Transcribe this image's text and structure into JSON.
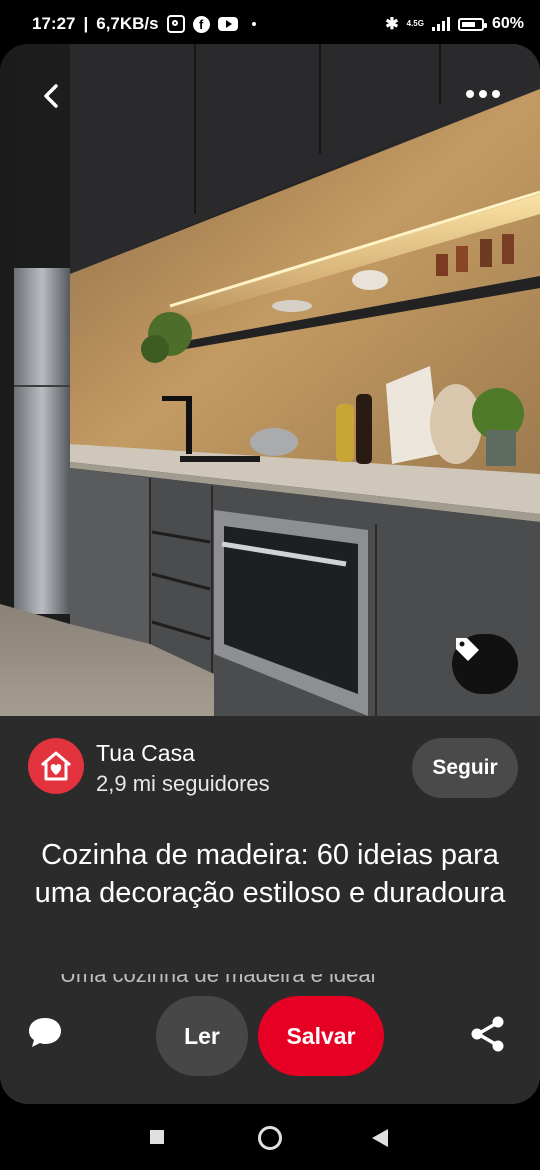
{
  "status_bar": {
    "time": "17:27",
    "speed": "6,7KB/s",
    "network": "4.5G",
    "battery": "60%"
  },
  "icons": {
    "back": "chevron-left-icon",
    "more": "more-horizontal-icon",
    "tag": "tag-icon",
    "comment": "speech-bubble-icon",
    "share": "share-icon"
  },
  "creator": {
    "name": "Tua Casa",
    "followers": "2,9 mi seguidores",
    "follow_label": "Seguir"
  },
  "pin": {
    "title": "Cozinha de madeira: 60 ideias para uma decoração estiloso e duradoura",
    "description_peek": "Uma cozinha de madeira é ideal"
  },
  "actions": {
    "read_label": "Ler",
    "save_label": "Salvar"
  },
  "colors": {
    "save": "#e60023",
    "avatar": "#e3333e",
    "card": "#2b2b2b",
    "follow": "#4a4a4a"
  }
}
